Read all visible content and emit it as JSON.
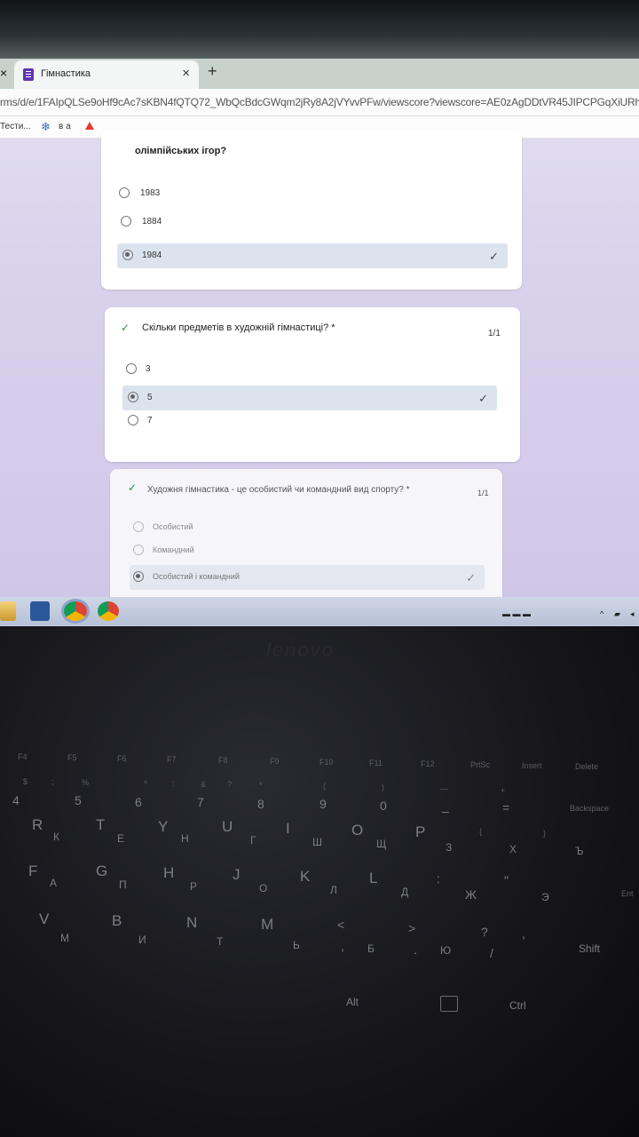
{
  "browser": {
    "tab_title": "Гімнастика",
    "tab_close": "×",
    "prev_tab_close": "×",
    "new_tab": "+",
    "url": "rms/d/e/1FAIpQLSe9oHf9cAc7sKBN4fQTQ72_WbQcBdcGWqm2jRy8A2jVYvvPFw/viewscore?viewscore=AE0zAgDDtVR45JIPCPGqXiURhi",
    "bookmarks": [
      "Тести...",
      "в а"
    ]
  },
  "quiz": {
    "q1": {
      "question_tail": "олімпійських ігор?",
      "options": [
        "1983",
        "1884",
        "1984"
      ],
      "selected_index": 2
    },
    "q2": {
      "question": "Скільки предметів в художній гімнастиці? *",
      "score": "1/1",
      "options": [
        "3",
        "5",
        "7"
      ],
      "selected_index": 1
    },
    "q3": {
      "question": "Художня гімнастика - це особистий чи командний вид спорту? *",
      "score": "1/1",
      "options": [
        "Особистий",
        "Командний",
        "Особистий і командний"
      ],
      "selected_index": 2
    },
    "correct_mark": "✓"
  },
  "taskbar": {
    "icons": [
      "file-explorer-icon",
      "word-icon",
      "chrome-icon",
      "chrome-icon"
    ]
  },
  "keyboard": {
    "brand": "lenovo",
    "rows": {
      "fn": [
        "F4",
        "F5",
        "F6",
        "F7",
        "F8",
        "F9",
        "F10",
        "F11",
        "F12",
        "PrtSc",
        "Insert",
        "Delete"
      ],
      "num_top": [
        "$",
        ";",
        "%",
        "^",
        ":",
        "&",
        "?",
        "*",
        "(",
        ")",
        "—",
        "+"
      ],
      "num": [
        "4",
        "5",
        "6",
        "7",
        "8",
        "9",
        "0",
        "_",
        "=",
        "Backspace"
      ],
      "q_lat": [
        "R",
        "T",
        "Y",
        "U",
        "I",
        "O",
        "P",
        "{",
        "}"
      ],
      "q_cyr": [
        "К",
        "Е",
        "Н",
        "Г",
        "Ш",
        "Щ",
        "З",
        "Х",
        "Ъ"
      ],
      "a_lat": [
        "F",
        "G",
        "H",
        "J",
        "K",
        "L",
        ":",
        "\""
      ],
      "a_cyr": [
        "А",
        "П",
        "Р",
        "О",
        "Л",
        "Д",
        "Ж",
        "Э"
      ],
      "enter": "Ent",
      "z_lat": [
        "V",
        "B",
        "N",
        "M",
        "<",
        ">",
        "?"
      ],
      "z_cyr": [
        "М",
        "И",
        "Т",
        "Ь",
        "Б",
        "Ю"
      ],
      "z_sym": [
        ",",
        ".",
        "/",
        ","
      ],
      "shift": "Shift",
      "bottom": [
        "Alt",
        "Ctrl"
      ]
    }
  }
}
